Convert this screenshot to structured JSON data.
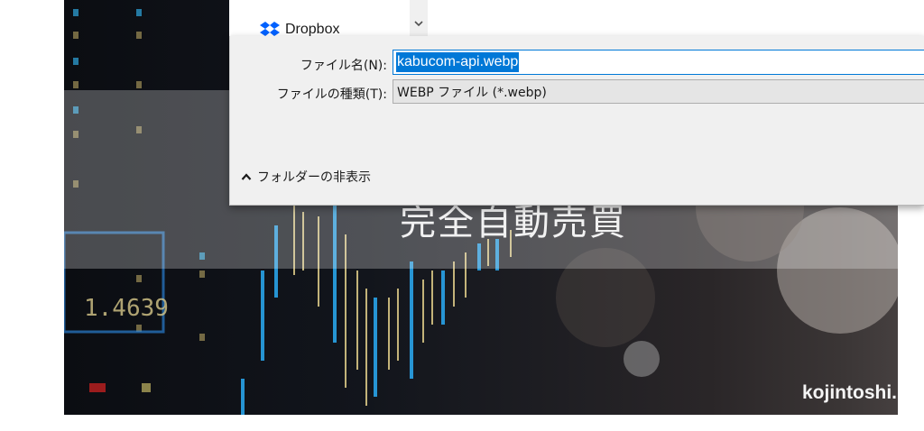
{
  "background": {
    "headline": "完全自動売買",
    "watermark": "kojintoshi.net"
  },
  "nav_pane": {
    "items": [
      {
        "label": "Dropbox",
        "icon": "dropbox-icon"
      }
    ]
  },
  "dialog": {
    "filename_label": "ファイル名(N):",
    "filename_value": "kabucom-api.webp",
    "filetype_label": "ファイルの種類(T):",
    "filetype_value": "WEBP ファイル (*.webp)",
    "hide_folders_label": "フォルダーの非表示"
  },
  "colors": {
    "selection": "#0078d7",
    "dialog_bg": "#f0f0f0",
    "dropbox_blue": "#0061fe"
  }
}
